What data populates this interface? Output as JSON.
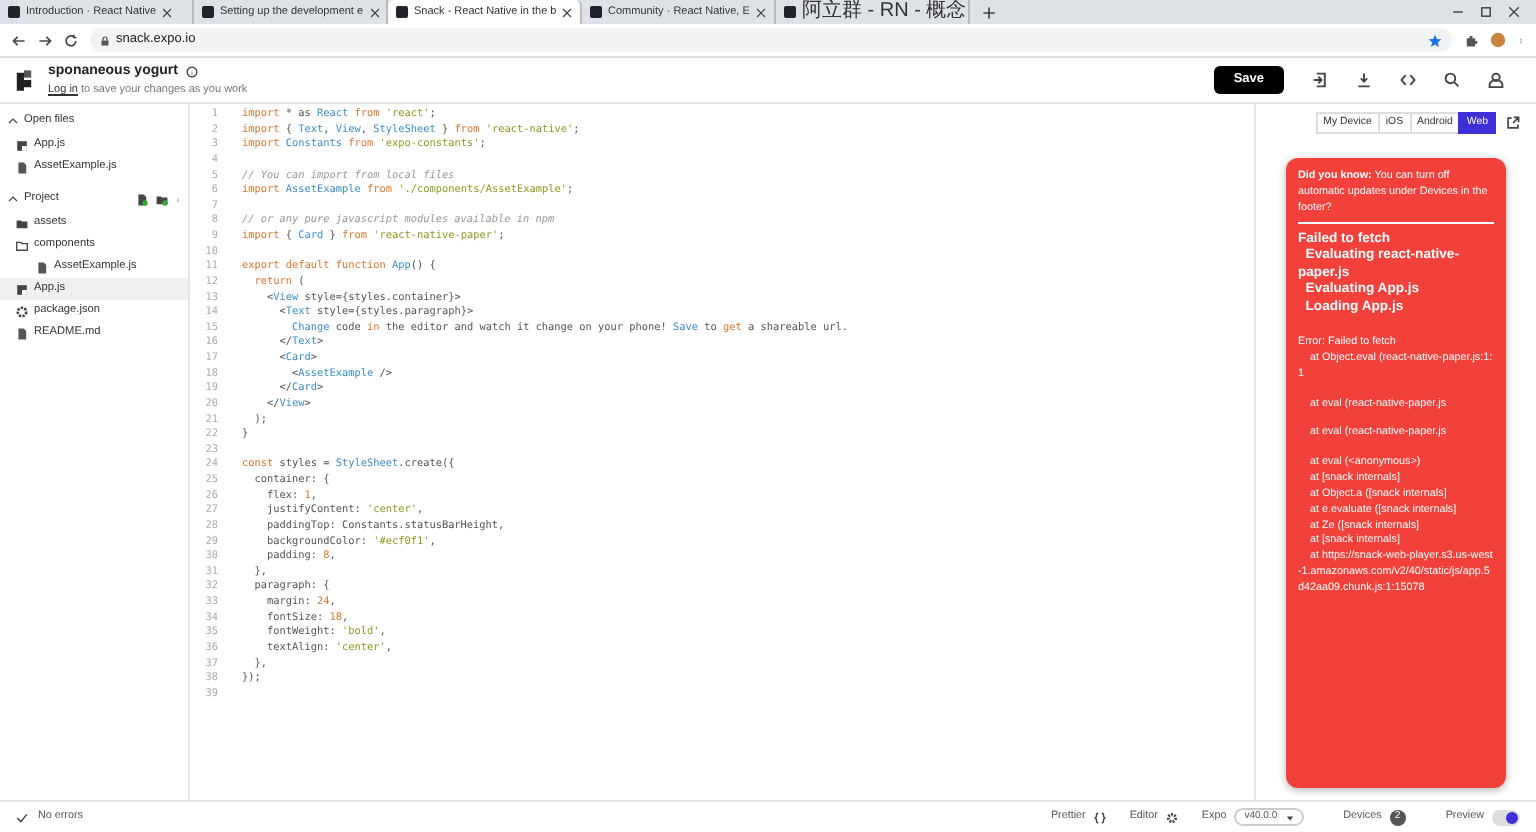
{
  "browser": {
    "tabs": [
      {
        "title": "Introduction · React Native",
        "selected": false
      },
      {
        "title": "Setting up the development e",
        "selected": false
      },
      {
        "title": "Snack - React Native in the b",
        "selected": true
      },
      {
        "title": "Community · React Native, E",
        "selected": false
      },
      {
        "title": "阿立群 - RN - 概念",
        "selected": false
      }
    ],
    "address": "snack.expo.io"
  },
  "header": {
    "project_name": "sponaneous yogurt",
    "login_link": "Log in",
    "login_hint": " to save your changes as you work",
    "save": "Save"
  },
  "sidebar": {
    "sections": [
      {
        "title": "Open files",
        "expanded": true,
        "items": [
          {
            "name": "App.js",
            "kind": "js",
            "selected": false
          },
          {
            "name": "AssetExample.js",
            "kind": "file",
            "selected": false
          }
        ]
      },
      {
        "title": "Project",
        "expanded": true,
        "items": [
          {
            "name": "assets",
            "kind": "folder",
            "selected": false
          },
          {
            "name": "components",
            "kind": "folder-open",
            "selected": false,
            "children": [
              {
                "name": "AssetExample.js",
                "kind": "file",
                "selected": false
              }
            ]
          },
          {
            "name": "App.js",
            "kind": "js",
            "selected": true
          },
          {
            "name": "package.json",
            "kind": "package",
            "selected": false
          },
          {
            "name": "README.md",
            "kind": "file",
            "selected": false
          }
        ]
      }
    ]
  },
  "editor": {
    "lines": [
      {
        "number": "1",
        "tokens": [
          {
            "text": "import",
            "kind": "keyword"
          },
          {
            "text": " * as ",
            "kind": "plain"
          },
          {
            "text": "React",
            "kind": "ident"
          },
          {
            "text": " from ",
            "kind": "keyword"
          },
          {
            "text": "'react'",
            "kind": "string"
          },
          {
            "text": ";",
            "kind": "plain"
          }
        ]
      },
      {
        "number": "2",
        "tokens": [
          {
            "text": "import",
            "kind": "keyword"
          },
          {
            "text": " { ",
            "kind": "plain"
          },
          {
            "text": "Text",
            "kind": "ident"
          },
          {
            "text": ", ",
            "kind": "plain"
          },
          {
            "text": "View",
            "kind": "ident"
          },
          {
            "text": ", ",
            "kind": "plain"
          },
          {
            "text": "StyleSheet",
            "kind": "ident"
          },
          {
            "text": " } ",
            "kind": "plain"
          },
          {
            "text": "from ",
            "kind": "keyword"
          },
          {
            "text": "'react-native'",
            "kind": "string"
          },
          {
            "text": ";",
            "kind": "plain"
          }
        ]
      },
      {
        "number": "3",
        "tokens": [
          {
            "text": "import ",
            "kind": "keyword"
          },
          {
            "text": "Constants",
            "kind": "ident"
          },
          {
            "text": " from ",
            "kind": "keyword"
          },
          {
            "text": "'expo-constants'",
            "kind": "string"
          },
          {
            "text": ";",
            "kind": "plain"
          }
        ]
      },
      {
        "number": "4"
      },
      {
        "number": "5",
        "tokens": [
          {
            "text": "// You can import from local files",
            "kind": "comment"
          }
        ]
      },
      {
        "number": "6",
        "tokens": [
          {
            "text": "import ",
            "kind": "keyword"
          },
          {
            "text": "AssetExample",
            "kind": "ident"
          },
          {
            "text": " from ",
            "kind": "keyword"
          },
          {
            "text": "'./components/AssetExample'",
            "kind": "string"
          },
          {
            "text": ";",
            "kind": "plain"
          }
        ]
      },
      {
        "number": "7"
      },
      {
        "number": "8",
        "tokens": [
          {
            "text": "// or any pure javascript modules available in npm",
            "kind": "comment"
          }
        ]
      },
      {
        "number": "9",
        "tokens": [
          {
            "text": "import",
            "kind": "keyword"
          },
          {
            "text": " { ",
            "kind": "plain"
          },
          {
            "text": "Card",
            "kind": "ident"
          },
          {
            "text": " } ",
            "kind": "plain"
          },
          {
            "text": "from ",
            "kind": "keyword"
          },
          {
            "text": "'react-native-paper'",
            "kind": "string"
          },
          {
            "text": ";",
            "kind": "plain"
          }
        ]
      },
      {
        "number": "10"
      },
      {
        "number": "11",
        "tokens": [
          {
            "text": "export default function ",
            "kind": "keyword"
          },
          {
            "text": "App",
            "kind": "ident"
          },
          {
            "text": "() {",
            "kind": "plain"
          }
        ]
      },
      {
        "number": "12",
        "tokens": [
          {
            "text": "  return",
            "kind": "keyword"
          },
          {
            "text": " (",
            "kind": "plain"
          }
        ]
      },
      {
        "number": "13",
        "tokens": [
          {
            "text": "    <",
            "kind": "plain"
          },
          {
            "text": "View",
            "kind": "ident"
          },
          {
            "text": " style={styles.container}>",
            "kind": "plain"
          }
        ]
      },
      {
        "number": "14",
        "tokens": [
          {
            "text": "      <",
            "kind": "plain"
          },
          {
            "text": "Text",
            "kind": "ident"
          },
          {
            "text": " style={styles.paragraph}>",
            "kind": "plain"
          }
        ]
      },
      {
        "number": "15",
        "tokens": [
          {
            "text": "        Change",
            "kind": "ident"
          },
          {
            "text": " code ",
            "kind": "plain"
          },
          {
            "text": "in",
            "kind": "keyword"
          },
          {
            "text": " the editor and watch it change on your phone! ",
            "kind": "plain"
          },
          {
            "text": "Save",
            "kind": "ident"
          },
          {
            "text": " to ",
            "kind": "plain"
          },
          {
            "text": "get",
            "kind": "keyword"
          },
          {
            "text": " a shareable url.",
            "kind": "plain"
          }
        ]
      },
      {
        "number": "16",
        "tokens": [
          {
            "text": "      </",
            "kind": "plain"
          },
          {
            "text": "Text",
            "kind": "ident"
          },
          {
            "text": ">",
            "kind": "plain"
          }
        ]
      },
      {
        "number": "17",
        "tokens": [
          {
            "text": "      <",
            "kind": "plain"
          },
          {
            "text": "Card",
            "kind": "ident"
          },
          {
            "text": ">",
            "kind": "plain"
          }
        ]
      },
      {
        "number": "18",
        "tokens": [
          {
            "text": "        <",
            "kind": "plain"
          },
          {
            "text": "AssetExample",
            "kind": "ident"
          },
          {
            "text": " />",
            "kind": "plain"
          }
        ]
      },
      {
        "number": "19",
        "tokens": [
          {
            "text": "      </",
            "kind": "plain"
          },
          {
            "text": "Card",
            "kind": "ident"
          },
          {
            "text": ">",
            "kind": "plain"
          }
        ]
      },
      {
        "number": "20",
        "tokens": [
          {
            "text": "    </",
            "kind": "plain"
          },
          {
            "text": "View",
            "kind": "ident"
          },
          {
            "text": ">",
            "kind": "plain"
          }
        ]
      },
      {
        "number": "21",
        "tokens": [
          {
            "text": "  );",
            "kind": "plain"
          }
        ]
      },
      {
        "number": "22",
        "tokens": [
          {
            "text": "}",
            "kind": "plain"
          }
        ]
      },
      {
        "number": "23"
      },
      {
        "number": "24",
        "tokens": [
          {
            "text": "const",
            "kind": "keyword"
          },
          {
            "text": " styles = ",
            "kind": "plain"
          },
          {
            "text": "StyleSheet",
            "kind": "ident"
          },
          {
            "text": ".create({",
            "kind": "plain"
          }
        ]
      },
      {
        "number": "25",
        "tokens": [
          {
            "text": "  container: {",
            "kind": "plain"
          }
        ]
      },
      {
        "number": "26",
        "tokens": [
          {
            "text": "    flex: ",
            "kind": "plain"
          },
          {
            "text": "1",
            "kind": "number"
          },
          {
            "text": ",",
            "kind": "plain"
          }
        ]
      },
      {
        "number": "27",
        "tokens": [
          {
            "text": "    justifyContent: ",
            "kind": "plain"
          },
          {
            "text": "'center'",
            "kind": "string"
          },
          {
            "text": ",",
            "kind": "plain"
          }
        ]
      },
      {
        "number": "28",
        "tokens": [
          {
            "text": "    paddingTop: Constants.statusBarHeight,",
            "kind": "plain"
          }
        ]
      },
      {
        "number": "29",
        "tokens": [
          {
            "text": "    backgroundColor: ",
            "kind": "plain"
          },
          {
            "text": "'#ecf0f1'",
            "kind": "string"
          },
          {
            "text": ",",
            "kind": "plain"
          }
        ]
      },
      {
        "number": "30",
        "tokens": [
          {
            "text": "    padding: ",
            "kind": "plain"
          },
          {
            "text": "8",
            "kind": "number"
          },
          {
            "text": ",",
            "kind": "plain"
          }
        ]
      },
      {
        "number": "31",
        "tokens": [
          {
            "text": "  },",
            "kind": "plain"
          }
        ]
      },
      {
        "number": "32",
        "tokens": [
          {
            "text": "  paragraph: {",
            "kind": "plain"
          }
        ]
      },
      {
        "number": "33",
        "tokens": [
          {
            "text": "    margin: ",
            "kind": "plain"
          },
          {
            "text": "24",
            "kind": "number"
          },
          {
            "text": ",",
            "kind": "plain"
          }
        ]
      },
      {
        "number": "34",
        "tokens": [
          {
            "text": "    fontSize: ",
            "kind": "plain"
          },
          {
            "text": "18",
            "kind": "number"
          },
          {
            "text": ",",
            "kind": "plain"
          }
        ]
      },
      {
        "number": "35",
        "tokens": [
          {
            "text": "    fontWeight: ",
            "kind": "plain"
          },
          {
            "text": "'bold'",
            "kind": "string"
          },
          {
            "text": ",",
            "kind": "plain"
          }
        ]
      },
      {
        "number": "36",
        "tokens": [
          {
            "text": "    textAlign: ",
            "kind": "plain"
          },
          {
            "text": "'center'",
            "kind": "string"
          },
          {
            "text": ",",
            "kind": "plain"
          }
        ]
      },
      {
        "number": "37",
        "tokens": [
          {
            "text": "  },",
            "kind": "plain"
          }
        ]
      },
      {
        "number": "38",
        "tokens": [
          {
            "text": "});",
            "kind": "plain"
          }
        ]
      },
      {
        "number": "39"
      }
    ]
  },
  "preview": {
    "devices": [
      {
        "label": "My Device",
        "selected": false
      },
      {
        "label": "iOS",
        "selected": false
      },
      {
        "label": "Android",
        "selected": false
      },
      {
        "label": "Web",
        "selected": true
      }
    ],
    "error_card": {
      "tip": "**Did you know:** You can turn off automatic updates under Devices in the footer?",
      "headline": [
        "Failed to fetch",
        "  Evaluating react-native-paper.js",
        "  Evaluating App.js",
        "  Loading App.js"
      ],
      "stack": [
        {
          "text": "Error: Failed to fetch",
          "gap_before": false
        },
        {
          "text": "    at Object.eval (react-native-paper.js:1:1",
          "gap_before": false
        },
        {
          "text": "    at eval (react-native-paper.js",
          "gap_before": true
        },
        {
          "text": "    at eval (react-native-paper.js",
          "gap_before": true
        },
        {
          "text": "    at eval (<anonymous>)",
          "gap_before": true
        },
        {
          "text": "    at [snack internals]",
          "gap_before": false
        },
        {
          "text": "    at Object.a ([snack internals]",
          "gap_before": false
        },
        {
          "text": "    at e.evaluate ([snack internals]",
          "gap_before": false
        },
        {
          "text": "    at Ze ([snack internals]",
          "gap_before": false
        },
        {
          "text": "    at [snack internals]",
          "gap_before": false
        },
        {
          "text": "    at https://snack-web-player.s3.us-west-1.amazonaws.com/v2/40/static/js/app.5d42aa09.chunk.js:1:15078",
          "gap_before": false
        }
      ]
    }
  },
  "status_bar": {
    "errors": "No errors",
    "prettier": "Prettier",
    "editor": "Editor",
    "expo": "Expo",
    "expo_version": "v40.0.0",
    "devices": "Devices",
    "device_count": "2",
    "preview": "Preview",
    "preview_on": true
  }
}
